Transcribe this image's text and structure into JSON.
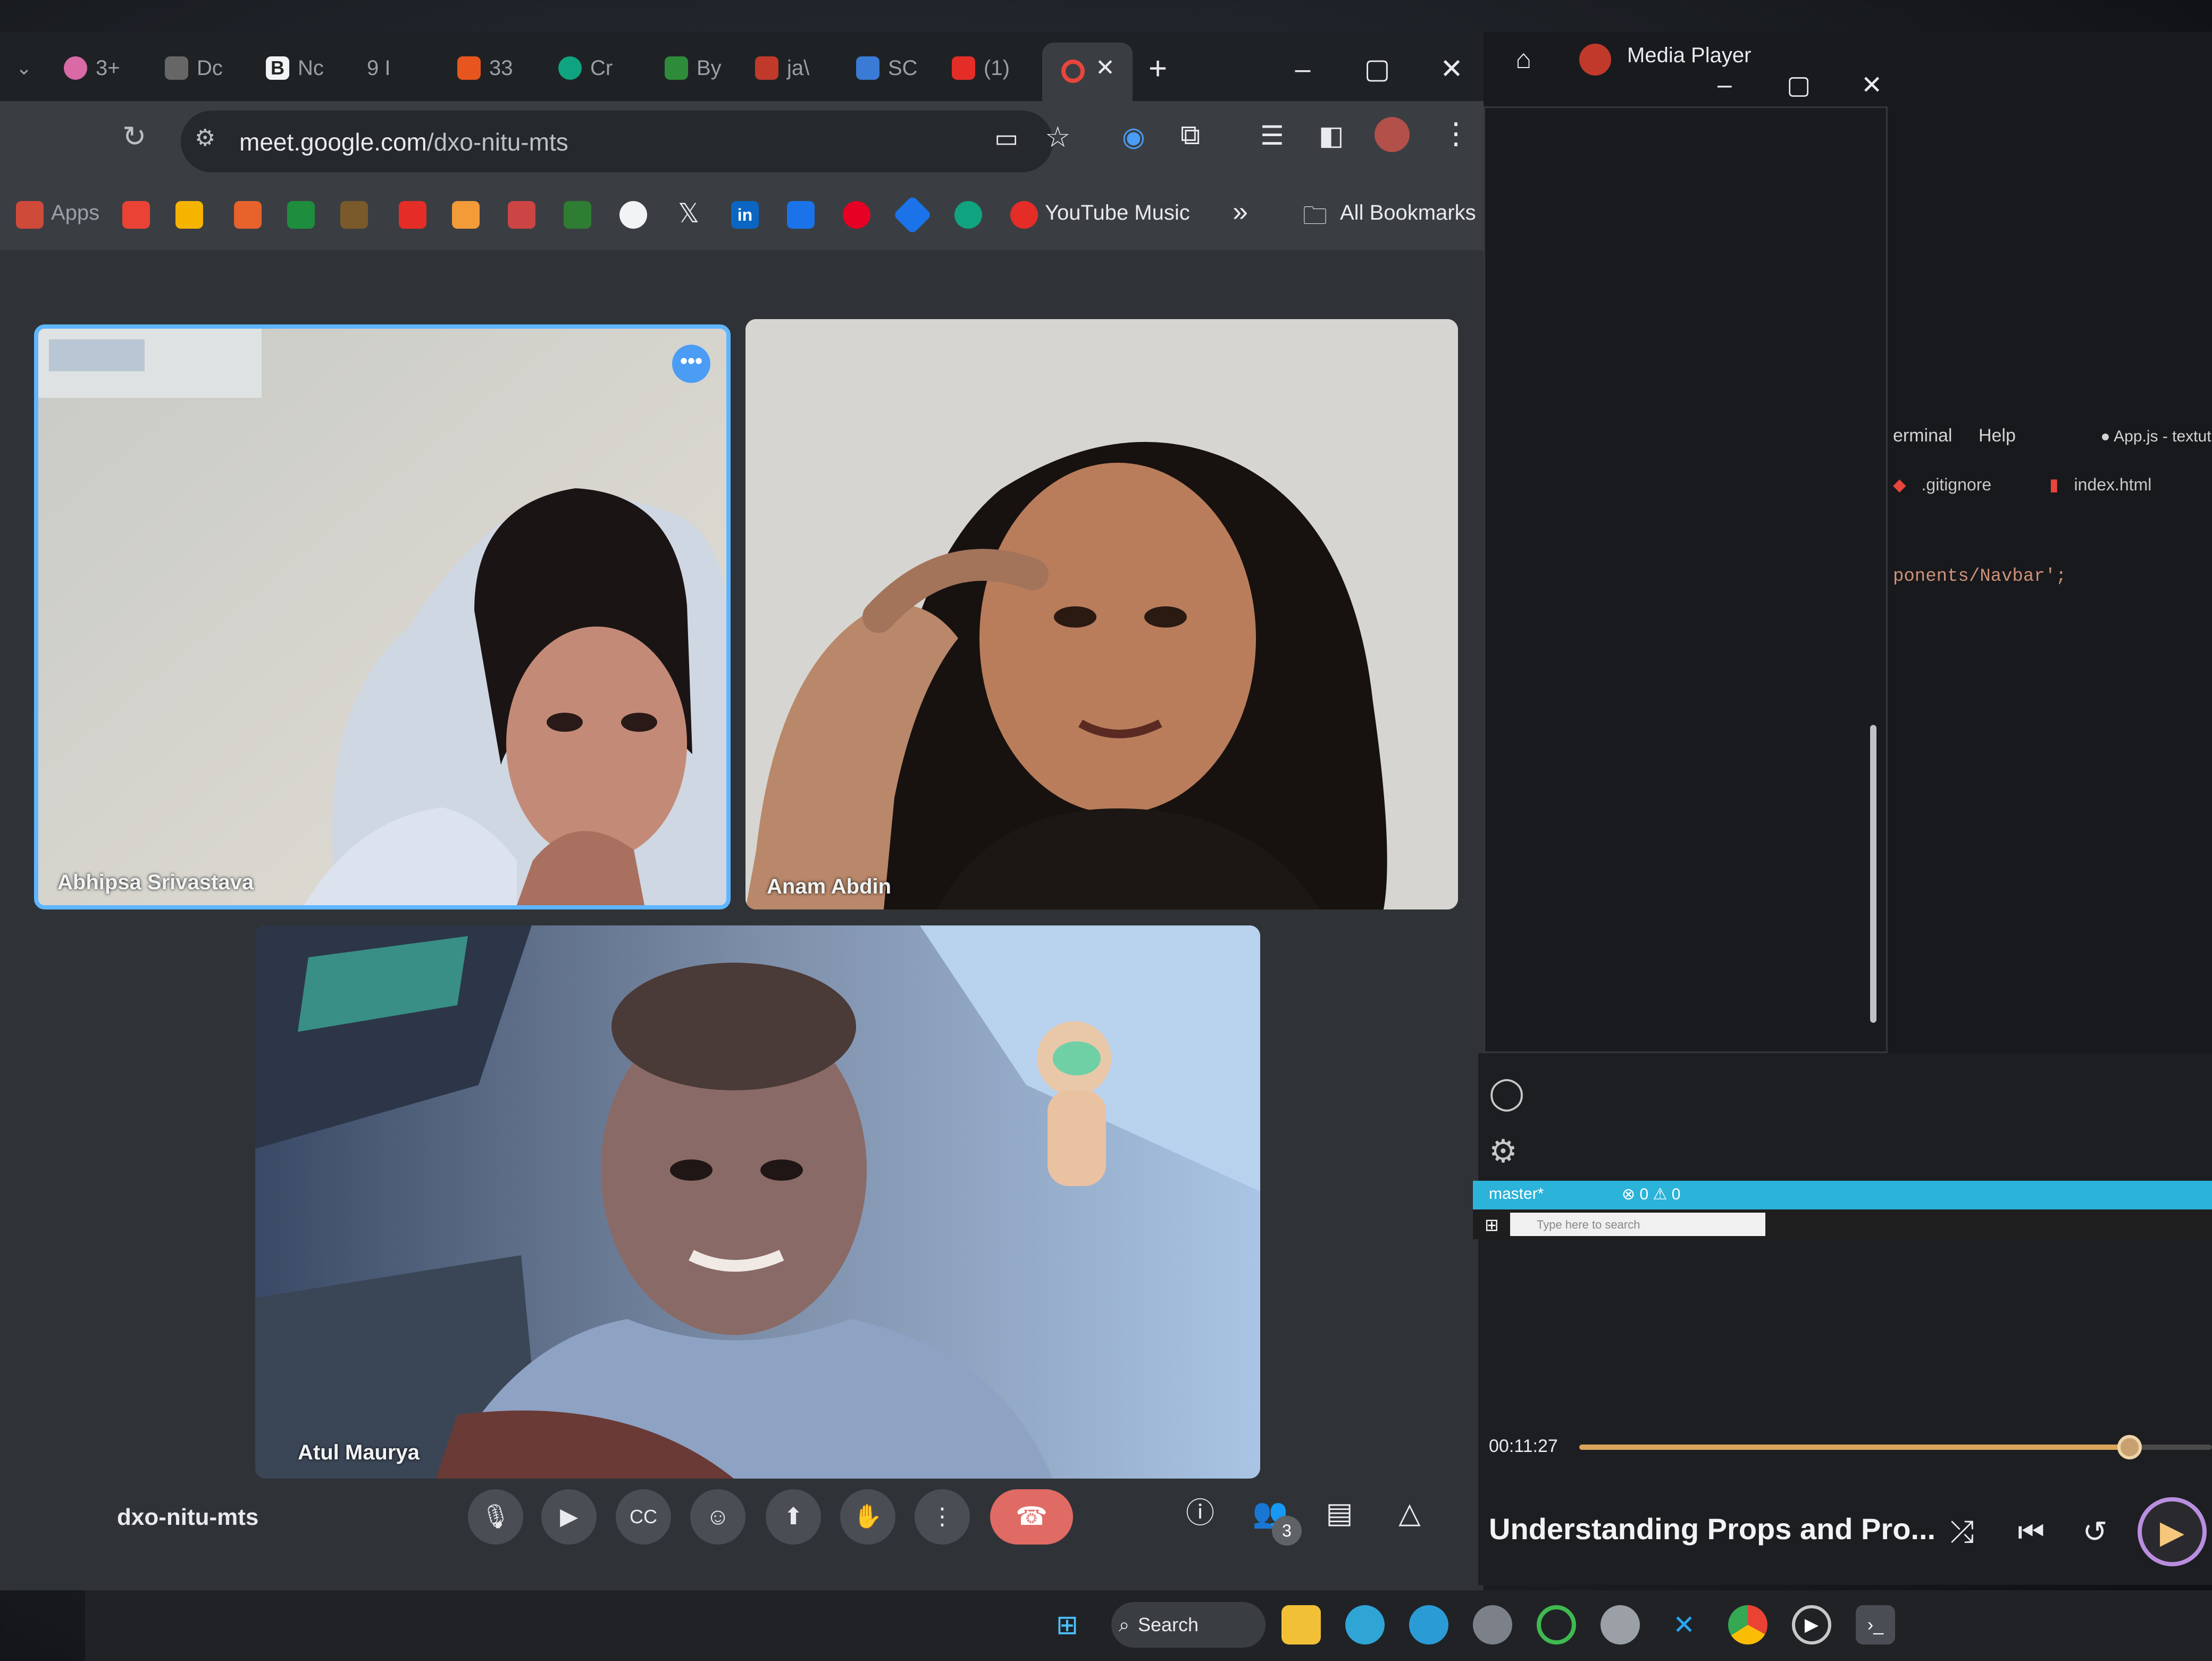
{
  "browser": {
    "tabs": [
      "3+",
      "Dc",
      "Nc",
      "9 I",
      "33",
      "Cr",
      "By",
      "ja\\",
      "SC",
      "(1)"
    ],
    "new_tab": "+",
    "url_host": "meet.google.com",
    "url_path": "/dxo-nitu-mts",
    "bookmarks": {
      "apps": "Apps",
      "youtube_music": "YouTube Music",
      "more": "»",
      "all_bookmarks": "All Bookmarks"
    }
  },
  "meet": {
    "participants": [
      {
        "name": "Abhipsa Srivastava",
        "pinned": true
      },
      {
        "name": "Anam Abdin",
        "pinned": false
      },
      {
        "name": "Atul Maurya",
        "pinned": false
      }
    ],
    "meeting_code": "dxo-nitu-mts",
    "people_count": "3",
    "tile_menu": "•••"
  },
  "media_player": {
    "title": "Media Player",
    "current_time": "00:11:27",
    "progress": 0.87,
    "track_title": "Understanding Props and Pro...",
    "accent_color": "#b98ee0"
  },
  "editor": {
    "menu": [
      "erminal",
      "Help"
    ],
    "file_title": "● App.js - textutil",
    "tabs": [
      ".gitignore",
      "index.html"
    ],
    "code_line": "ponents/Navbar';",
    "branch": "master*",
    "problems": "⊗ 0 ⚠ 0",
    "search_placeholder": "Type here to search"
  },
  "taskbar": {
    "search_label": "Search"
  },
  "icons": {
    "reload": "reload-icon",
    "star": "star-icon",
    "mic": "mic-icon",
    "camera": "camera-icon",
    "captions": "captions-icon",
    "emoji": "emoji-icon",
    "present": "present-icon",
    "hand": "raise-hand-icon",
    "more": "more-options-icon",
    "end_call": "end-call-icon",
    "info": "info-icon",
    "people": "people-icon",
    "chat": "chat-icon",
    "activities": "activities-icon"
  }
}
